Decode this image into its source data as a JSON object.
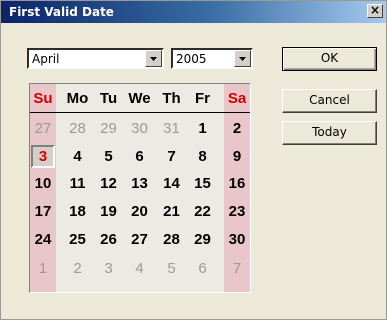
{
  "window": {
    "title": "First Valid Date",
    "close_glyph": "✕"
  },
  "selectors": {
    "month": "April",
    "year": "2005"
  },
  "buttons": {
    "ok": "OK",
    "cancel": "Cancel",
    "today": "Today"
  },
  "calendar": {
    "weekdays": [
      "Su",
      "Mo",
      "Tu",
      "We",
      "Th",
      "Fr",
      "Sa"
    ],
    "selected_day": "3",
    "weeks": [
      [
        {
          "d": "27",
          "m": "prev"
        },
        {
          "d": "28",
          "m": "prev"
        },
        {
          "d": "29",
          "m": "prev"
        },
        {
          "d": "30",
          "m": "prev"
        },
        {
          "d": "31",
          "m": "prev"
        },
        {
          "d": "1",
          "m": "cur"
        },
        {
          "d": "2",
          "m": "cur"
        }
      ],
      [
        {
          "d": "3",
          "m": "cur"
        },
        {
          "d": "4",
          "m": "cur"
        },
        {
          "d": "5",
          "m": "cur"
        },
        {
          "d": "6",
          "m": "cur"
        },
        {
          "d": "7",
          "m": "cur"
        },
        {
          "d": "8",
          "m": "cur"
        },
        {
          "d": "9",
          "m": "cur"
        }
      ],
      [
        {
          "d": "10",
          "m": "cur"
        },
        {
          "d": "11",
          "m": "cur"
        },
        {
          "d": "12",
          "m": "cur"
        },
        {
          "d": "13",
          "m": "cur"
        },
        {
          "d": "14",
          "m": "cur"
        },
        {
          "d": "15",
          "m": "cur"
        },
        {
          "d": "16",
          "m": "cur"
        }
      ],
      [
        {
          "d": "17",
          "m": "cur"
        },
        {
          "d": "18",
          "m": "cur"
        },
        {
          "d": "19",
          "m": "cur"
        },
        {
          "d": "20",
          "m": "cur"
        },
        {
          "d": "21",
          "m": "cur"
        },
        {
          "d": "22",
          "m": "cur"
        },
        {
          "d": "23",
          "m": "cur"
        }
      ],
      [
        {
          "d": "24",
          "m": "cur"
        },
        {
          "d": "25",
          "m": "cur"
        },
        {
          "d": "26",
          "m": "cur"
        },
        {
          "d": "27",
          "m": "cur"
        },
        {
          "d": "28",
          "m": "cur"
        },
        {
          "d": "29",
          "m": "cur"
        },
        {
          "d": "30",
          "m": "cur"
        }
      ],
      [
        {
          "d": "1",
          "m": "next"
        },
        {
          "d": "2",
          "m": "next"
        },
        {
          "d": "3",
          "m": "next"
        },
        {
          "d": "4",
          "m": "next"
        },
        {
          "d": "5",
          "m": "next"
        },
        {
          "d": "6",
          "m": "next"
        },
        {
          "d": "7",
          "m": "next"
        }
      ]
    ]
  },
  "colors": {
    "weekend_header": "#d40000",
    "weekend_column": "#e9c6ca",
    "other_month": "#9a9a9a",
    "title_bar": "#0a246a"
  }
}
